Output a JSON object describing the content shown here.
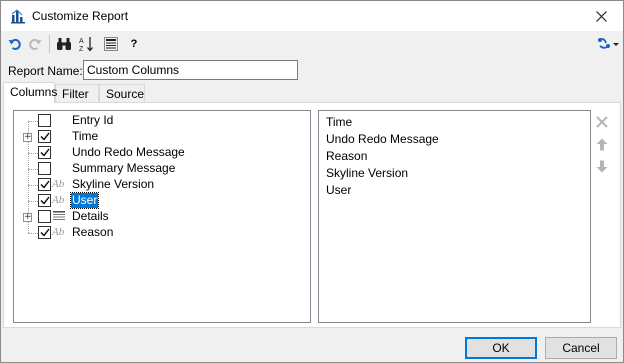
{
  "window": {
    "title": "Customize Report"
  },
  "toolbar": {
    "undo_icon": "undo-icon",
    "redo_icon": "redo-icon",
    "find_icon": "binoculars-icon",
    "sort_icon": "sort-az-icon",
    "columns_icon": "column-grid-icon",
    "help_label": "?",
    "share_icon": "share-dropdown-icon"
  },
  "report_name": {
    "label": "Report Name:",
    "value": "Custom Columns"
  },
  "tabs": [
    {
      "label": "Columns",
      "active": true
    },
    {
      "label": "Filter",
      "active": false
    },
    {
      "label": "Source",
      "active": false
    }
  ],
  "tree": {
    "items": [
      {
        "label": "Entry Id",
        "checked": false,
        "expandable": false,
        "type_icon": ""
      },
      {
        "label": "Time",
        "checked": true,
        "expandable": true,
        "type_icon": ""
      },
      {
        "label": "Undo Redo Message",
        "checked": true,
        "expandable": false,
        "type_icon": ""
      },
      {
        "label": "Summary Message",
        "checked": false,
        "expandable": false,
        "type_icon": ""
      },
      {
        "label": "Skyline Version",
        "checked": true,
        "expandable": false,
        "type_icon": "Ab"
      },
      {
        "label": "User",
        "checked": true,
        "expandable": false,
        "type_icon": "Ab",
        "selected": true
      },
      {
        "label": "Details",
        "checked": false,
        "expandable": true,
        "type_icon": "list"
      },
      {
        "label": "Reason",
        "checked": true,
        "expandable": false,
        "type_icon": "Ab"
      }
    ]
  },
  "selected_columns": [
    "Time",
    "Undo Redo Message",
    "Reason",
    "Skyline Version",
    "User"
  ],
  "side_buttons": {
    "remove_icon": "remove-x-icon",
    "up_icon": "move-up-icon",
    "down_icon": "move-down-icon"
  },
  "buttons": {
    "ok": "OK",
    "cancel": "Cancel"
  },
  "colors": {
    "selection": "#0078d7",
    "accent": "#0078d7",
    "window_bg": "#f0f0f0"
  }
}
